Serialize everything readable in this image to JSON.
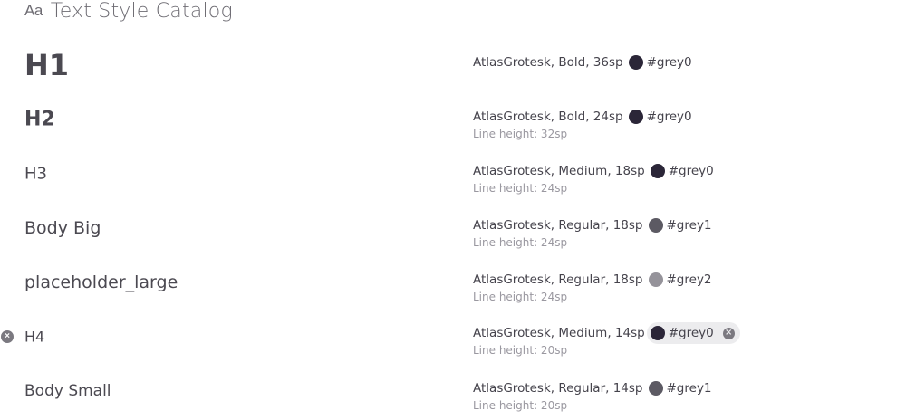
{
  "header": {
    "icon_text": "Aa",
    "title": "Text Style Catalog"
  },
  "colors": {
    "grey0": "#2b2638",
    "grey1": "#5c5a63",
    "grey2": "#95939a",
    "chip_bg": "#ececee"
  },
  "styles": [
    {
      "name": "H1",
      "spec": "AtlasGrotesk, Bold, 36sp",
      "color_name": "#grey0",
      "line_height": ""
    },
    {
      "name": "H2",
      "spec": "AtlasGrotesk, Bold, 24sp",
      "color_name": "#grey0",
      "line_height": "Line height: 32sp"
    },
    {
      "name": "H3",
      "spec": "AtlasGrotesk, Medium, 18sp",
      "color_name": "#grey0",
      "line_height": "Line height: 24sp"
    },
    {
      "name": "Body Big",
      "spec": "AtlasGrotesk, Regular, 18sp",
      "color_name": "#grey1",
      "line_height": "Line height: 24sp"
    },
    {
      "name": "placeholder_large",
      "spec": "AtlasGrotesk, Regular, 18sp",
      "color_name": "#grey2",
      "line_height": "Line height: 24sp"
    },
    {
      "name": "H4",
      "spec": "AtlasGrotesk, Medium, 14sp",
      "color_name": "#grey0",
      "line_height": "Line height: 20sp"
    },
    {
      "name": "Body Small",
      "spec": "AtlasGrotesk, Regular, 14sp",
      "color_name": "#grey1",
      "line_height": "Line height: 20sp"
    }
  ],
  "icons": {
    "close_glyph": "×"
  }
}
